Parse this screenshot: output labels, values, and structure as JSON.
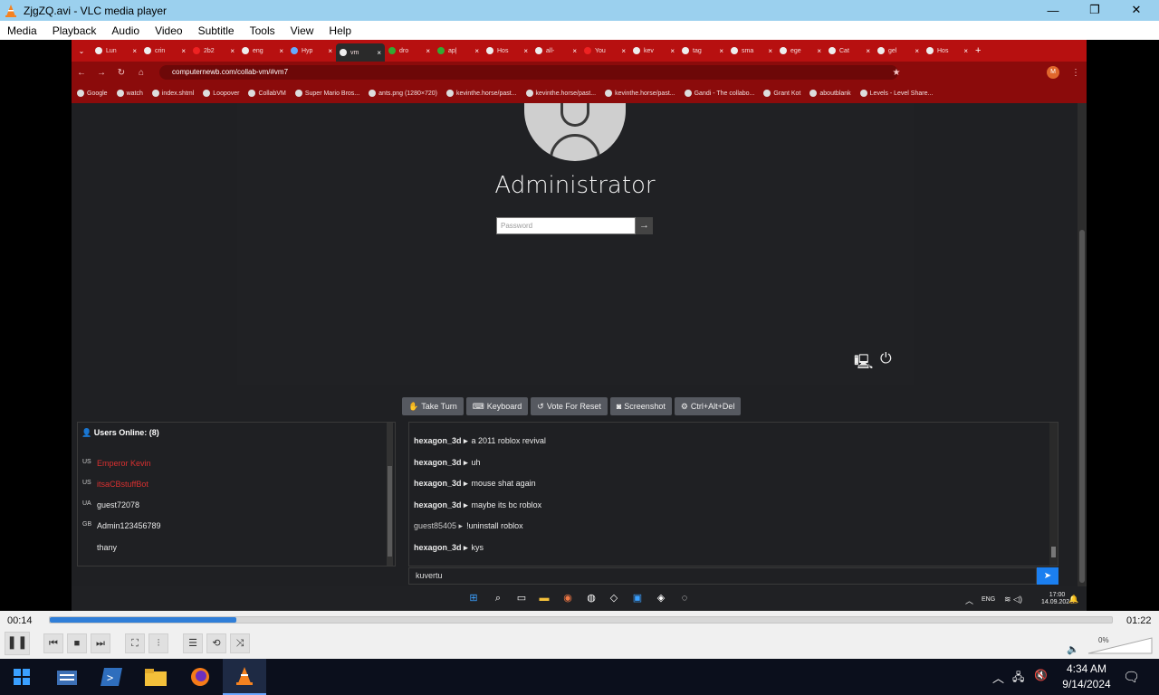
{
  "window": {
    "title": "ZjgZQ.avi - VLC media player",
    "minimize": "—",
    "maximize": "❐",
    "close": "✕"
  },
  "menu": [
    "Media",
    "Playback",
    "Audio",
    "Video",
    "Subtitle",
    "Tools",
    "View",
    "Help"
  ],
  "browser": {
    "tabs": [
      "Lun",
      "crin",
      "2b2",
      "eng",
      "Hyp",
      "vm",
      "dro",
      "ap|",
      "Hos",
      "all-",
      "You",
      "kev",
      "tag",
      "sma",
      "ege",
      "Cat",
      "gel",
      "Hos"
    ],
    "url": "computernewb.com/collab-vm/#vm7",
    "bookmarks": [
      "Google",
      "watch",
      "index.shtml",
      "Loopover",
      "CollabVM",
      "Super Mario Bros...",
      "ants.png (1280×720)",
      "kevinthe.horse/past...",
      "kevinthe.horse/past...",
      "kevinthe.horse/past...",
      "Gandi - The collabo...",
      "Grant Kot",
      "aboutblank",
      "Levels - Level Share..."
    ]
  },
  "vm": {
    "username": "Administrator",
    "password_placeholder": "Password",
    "buttons": [
      "Take Turn",
      "Keyboard",
      "Vote For Reset",
      "Screenshot",
      "Ctrl+Alt+Del"
    ]
  },
  "users": {
    "header": "Users Online: (8)",
    "list": [
      {
        "cc": "US",
        "name": "Emperor Kevin",
        "red": true
      },
      {
        "cc": "US",
        "name": "itsaCBstuffBot",
        "red": true
      },
      {
        "cc": "UA",
        "name": "guest72078",
        "red": false
      },
      {
        "cc": "GB",
        "name": "Admin123456789",
        "red": false
      },
      {
        "cc": "",
        "name": "thany",
        "red": false
      }
    ]
  },
  "chat": {
    "messages": [
      {
        "user": "hexagon_3d ▸",
        "text": "a 2011 roblox revival",
        "guest": false
      },
      {
        "user": "hexagon_3d ▸",
        "text": "uh",
        "guest": false
      },
      {
        "user": "hexagon_3d ▸",
        "text": "mouse shat again",
        "guest": false
      },
      {
        "user": "hexagon_3d ▸",
        "text": "maybe its bc roblox",
        "guest": false
      },
      {
        "user": "guest85405 ▸",
        "text": "!uninstall roblox",
        "guest": true
      },
      {
        "user": "hexagon_3d ▸",
        "text": "kys",
        "guest": false
      }
    ],
    "input_value": "kuvertu"
  },
  "vm_taskbar": {
    "lang": "ENG",
    "time": "17:00",
    "date": "14.09.2024"
  },
  "player": {
    "elapsed": "00:14",
    "total": "01:22",
    "progress_fraction": 0.176,
    "volume": "0%"
  },
  "host_taskbar": {
    "time": "4:34 AM",
    "date": "9/14/2024"
  },
  "colors": {
    "accent": "#2f7ed8",
    "browser_tab_red": "#b71010",
    "send_blue": "#1b7ff0"
  }
}
